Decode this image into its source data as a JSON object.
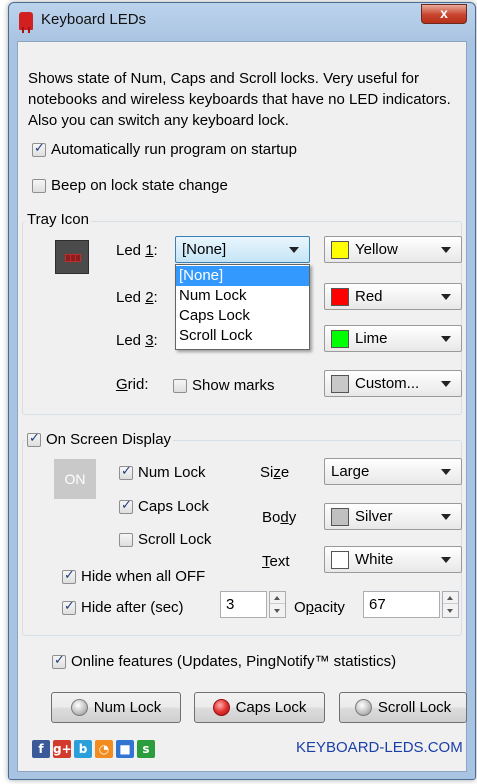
{
  "window": {
    "title": "Keyboard LEDs",
    "close_glyph": "x"
  },
  "description": "Shows state of Num, Caps and Scroll locks. Very useful for notebooks and wireless keyboards that have no LED indicators. Also you can switch any keyboard lock.",
  "options": {
    "autorun": {
      "label": "Automatically run program on startup",
      "checked": true
    },
    "beep": {
      "label": "Beep on lock state change",
      "checked": false
    }
  },
  "tray": {
    "title": "Tray Icon",
    "led1": {
      "label_pre": "Led ",
      "label_key": "1",
      "label_post": ":",
      "value": "[None]",
      "color_name": "Yellow",
      "color": "#ffff00"
    },
    "led2": {
      "label_pre": "Led ",
      "label_key": "2",
      "label_post": ":",
      "color_name": "Red",
      "color": "#ff0000"
    },
    "led3": {
      "label_pre": "Led ",
      "label_key": "3",
      "label_post": ":",
      "color_name": "Lime",
      "color": "#00ff00"
    },
    "grid": {
      "label_key": "G",
      "label_post": "rid:",
      "show_marks": "Show marks",
      "color_name": "Custom...",
      "color": "#c8c8c8"
    },
    "dropdown_options": [
      "[None]",
      "Num Lock",
      "Caps Lock",
      "Scroll Lock"
    ],
    "dropdown_selected": "[None]"
  },
  "osd": {
    "title": "On Screen Display",
    "enabled": true,
    "preview": "ON",
    "num_lock": {
      "label": "Num Lock",
      "checked": true
    },
    "caps_lock": {
      "label": "Caps Lock",
      "checked": true
    },
    "scroll_lock": {
      "label": "Scroll Lock",
      "checked": false
    },
    "size": {
      "label_pre": "Si",
      "label_key": "z",
      "label_post": "e",
      "value": "Large"
    },
    "body": {
      "label_pre": "Bo",
      "label_key": "d",
      "label_post": "y",
      "value": "Silver",
      "color": "#c0c0c0"
    },
    "text": {
      "label_key": "T",
      "label_post": "ext",
      "value": "White",
      "color": "#ffffff"
    },
    "hide_all_off": {
      "label": "Hide when all OFF",
      "checked": true
    },
    "hide_after": {
      "label": "Hide after (sec)",
      "checked": true,
      "value": "3"
    },
    "opacity": {
      "label_pre": "O",
      "label_key": "p",
      "label_post": "acity",
      "value": "67"
    }
  },
  "online": {
    "label": "Online features (Updates, PingNotify™ statistics)",
    "checked": true
  },
  "buttons": {
    "num_lock": {
      "label": "Num Lock",
      "state": "off"
    },
    "caps_lock": {
      "label": "Caps Lock",
      "state": "on"
    },
    "scroll_lock": {
      "label": "Scroll Lock",
      "state": "off"
    }
  },
  "footer": {
    "social_icons": [
      "facebook-icon",
      "google-plus-icon",
      "blogger-icon",
      "rss-icon",
      "delicious-icon",
      "stumbleupon-icon"
    ],
    "social_glyphs": [
      "f",
      "g+",
      "b",
      "◔",
      "■",
      "s"
    ],
    "social_colors": [
      "#3b5998",
      "#d23a2b",
      "#2b9fd9",
      "#f28c1e",
      "#3274d1",
      "#2a9e3c"
    ],
    "website": "KEYBOARD-LEDS.COM"
  }
}
